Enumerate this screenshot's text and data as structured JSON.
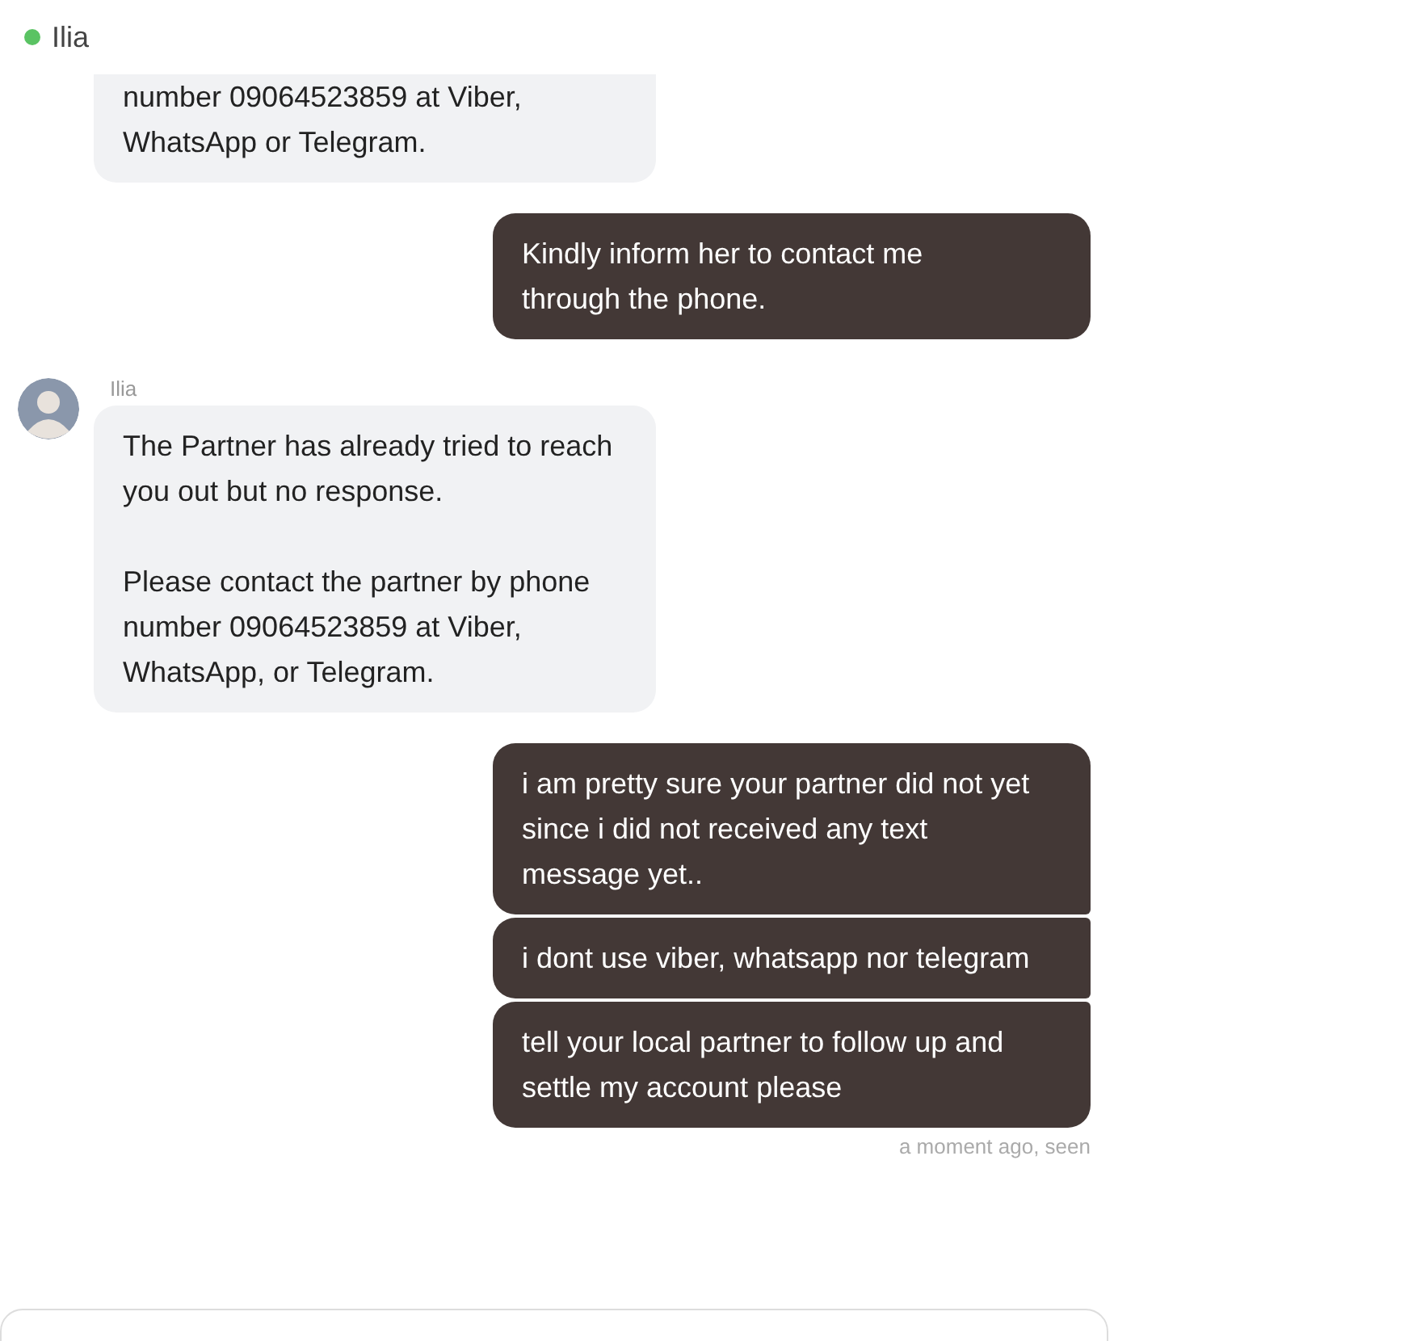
{
  "header": {
    "name": "Ilia",
    "online": true
  },
  "messages": [
    {
      "kind": "incoming",
      "paragraphs": [
        "number 09064523859 at Viber,\nWhatsApp or Telegram."
      ]
    },
    {
      "kind": "outgoing",
      "paragraphs": [
        "Kindly inform her to contact me\nthrough the phone."
      ]
    },
    {
      "kind": "incoming",
      "sender": "Ilia",
      "paragraphs": [
        "The Partner has already tried to reach\nyou out but no response.",
        "Please contact the partner by phone\nnumber 09064523859 at Viber,\nWhatsApp, or Telegram."
      ]
    },
    {
      "kind": "outgoing",
      "paragraphs": [
        "i am pretty sure your partner did not yet\nsince i did not received any text\nmessage yet.."
      ]
    },
    {
      "kind": "outgoing",
      "paragraphs": [
        "i dont use viber, whatsapp nor telegram"
      ]
    },
    {
      "kind": "outgoing",
      "paragraphs": [
        "tell your local partner to follow up and\nsettle my account please"
      ]
    }
  ],
  "status": "a moment ago, seen"
}
